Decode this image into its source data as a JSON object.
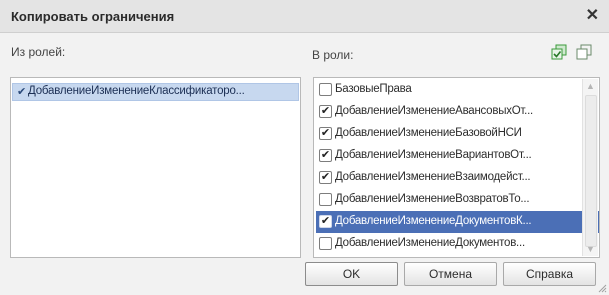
{
  "window": {
    "title": "Копировать ограничения"
  },
  "left": {
    "label": "Из ролей:",
    "items": [
      {
        "label": "ДобавлениеИзменениеКлассификаторо...",
        "checked": true
      }
    ]
  },
  "right": {
    "label": "В роли:",
    "icons": [
      "check-all-icon",
      "uncheck-all-icon"
    ],
    "items": [
      {
        "label": "БазовыеПрава",
        "checked": false
      },
      {
        "label": "ДобавлениеИзменениеАвансовыхОт...",
        "checked": true
      },
      {
        "label": "ДобавлениеИзменениеБазовойНСИ",
        "checked": true
      },
      {
        "label": "ДобавлениеИзменениеВариантовОт...",
        "checked": true
      },
      {
        "label": "ДобавлениеИзменениеВзаимодейст...",
        "checked": true
      },
      {
        "label": "ДобавлениеИзменениеВозвратовТо...",
        "checked": false
      },
      {
        "label": "ДобавлениеИзменениеДокументовК...",
        "checked": true,
        "selected": true
      },
      {
        "label": "ДобавлениеИзменениеДокументов...",
        "checked": false
      }
    ]
  },
  "buttons": {
    "ok": "OK",
    "cancel": "Отмена",
    "help": "Справка"
  },
  "colors": {
    "selection": "#4b6fb6",
    "titlebar": "#e4e4e4",
    "accent_icon": "#3a9a3a"
  }
}
